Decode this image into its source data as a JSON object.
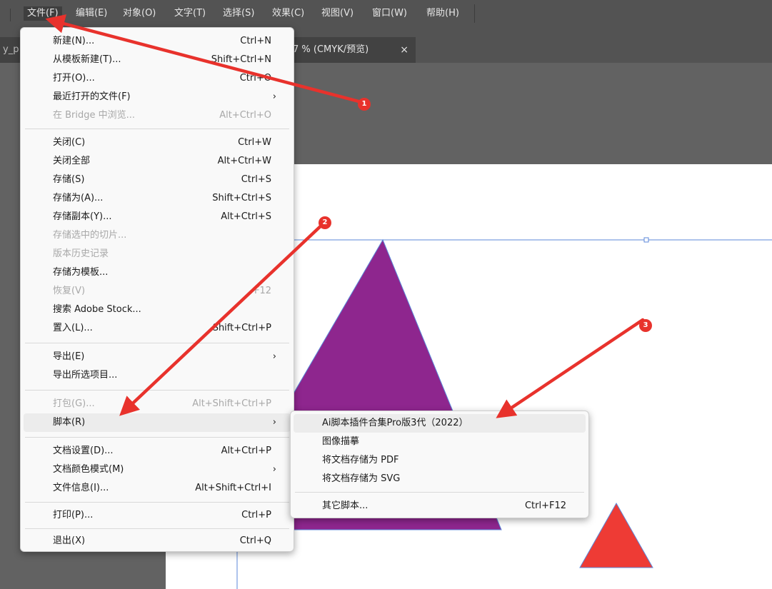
{
  "menubar": {
    "items": [
      {
        "label": "文件(F)"
      },
      {
        "label": "编辑(E)"
      },
      {
        "label": "对象(O)"
      },
      {
        "label": "文字(T)"
      },
      {
        "label": "选择(S)"
      },
      {
        "label": "效果(C)"
      },
      {
        "label": "视图(V)"
      },
      {
        "label": "窗口(W)"
      },
      {
        "label": "帮助(H)"
      }
    ]
  },
  "tabs": {
    "left_label": "y_p",
    "active_label": "7 % (CMYK/预览)",
    "close_glyph": "×"
  },
  "file_menu": {
    "items": [
      {
        "label": "新建(N)...",
        "shortcut": "Ctrl+N"
      },
      {
        "label": "从模板新建(T)...",
        "shortcut": "Shift+Ctrl+N"
      },
      {
        "label": "打开(O)...",
        "shortcut": "Ctrl+O"
      },
      {
        "label": "最近打开的文件(F)",
        "shortcut": "›"
      },
      {
        "label": "在 Bridge 中浏览...",
        "shortcut": "Alt+Ctrl+O"
      },
      {
        "label": "关闭(C)",
        "shortcut": "Ctrl+W"
      },
      {
        "label": "关闭全部",
        "shortcut": "Alt+Ctrl+W"
      },
      {
        "label": "存储(S)",
        "shortcut": "Ctrl+S"
      },
      {
        "label": "存储为(A)...",
        "shortcut": "Shift+Ctrl+S"
      },
      {
        "label": "存储副本(Y)...",
        "shortcut": "Alt+Ctrl+S"
      },
      {
        "label": "存储选中的切片..."
      },
      {
        "label": "版本历史记录"
      },
      {
        "label": "存储为模板..."
      },
      {
        "label": "恢复(V)",
        "shortcut": "F12"
      },
      {
        "label": "搜索 Adobe Stock..."
      },
      {
        "label": "置入(L)...",
        "shortcut": "Shift+Ctrl+P"
      },
      {
        "label": "导出(E)",
        "shortcut": "›"
      },
      {
        "label": "导出所选项目..."
      },
      {
        "label": "打包(G)...",
        "shortcut": "Alt+Shift+Ctrl+P"
      },
      {
        "label": "脚本(R)",
        "shortcut": "›"
      },
      {
        "label": "文档设置(D)...",
        "shortcut": "Alt+Ctrl+P"
      },
      {
        "label": "文档颜色模式(M)",
        "shortcut": "›"
      },
      {
        "label": "文件信息(I)...",
        "shortcut": "Alt+Shift+Ctrl+I"
      },
      {
        "label": "打印(P)...",
        "shortcut": "Ctrl+P"
      },
      {
        "label": "退出(X)",
        "shortcut": "Ctrl+Q"
      }
    ]
  },
  "script_submenu": {
    "items": [
      {
        "label": "Ai脚本插件合集Pro版3代（2022）"
      },
      {
        "label": "图像描摹"
      },
      {
        "label": "将文档存储为 PDF"
      },
      {
        "label": "将文档存储为 SVG"
      },
      {
        "label": "其它脚本...",
        "shortcut": "Ctrl+F12"
      }
    ]
  },
  "annotations": {
    "badges": [
      "1",
      "2",
      "3"
    ],
    "color": "#e8322c"
  },
  "colors": {
    "menubar_bg": "#535353",
    "workspace_bg": "#626262",
    "menu_bg": "#f9f9f9",
    "triangle_purple": "#8e268e",
    "triangle_red": "#ee3b35",
    "guide_blue": "#5b87d8"
  }
}
